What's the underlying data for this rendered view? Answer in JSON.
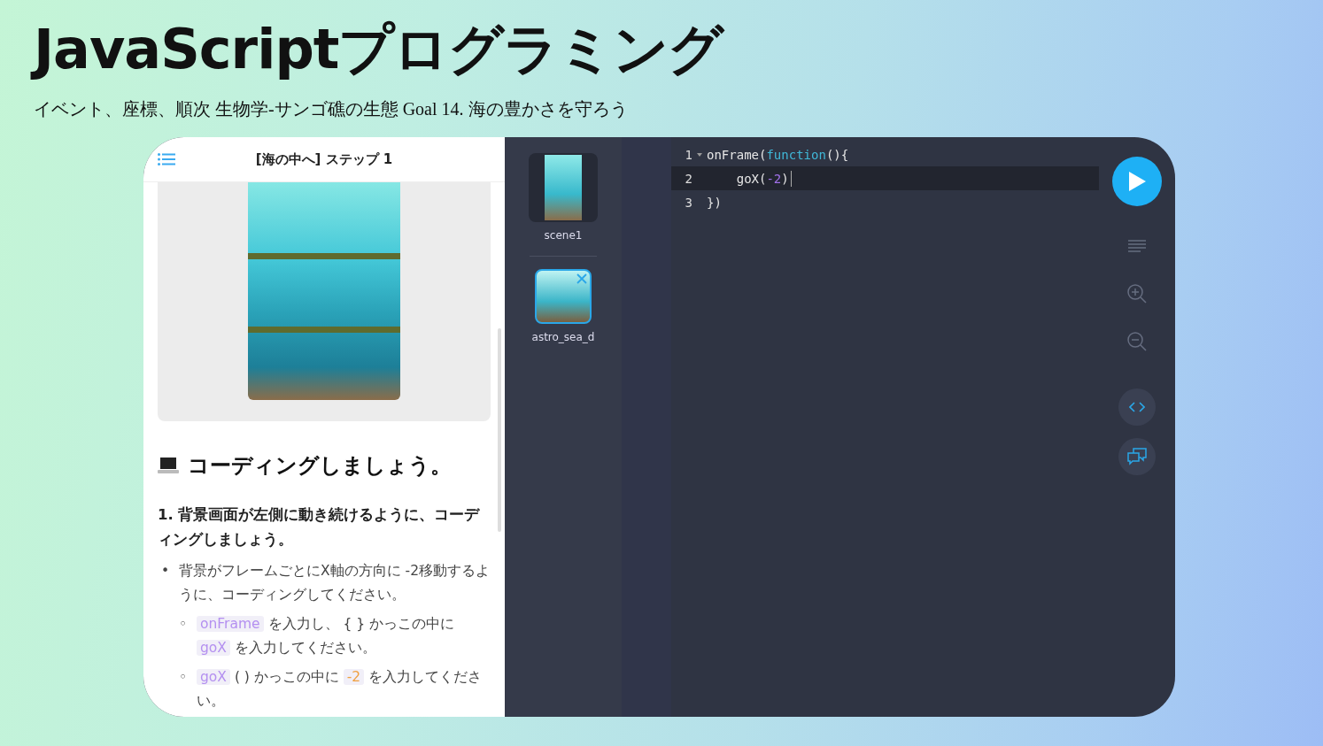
{
  "slide": {
    "title": "JavaScriptプログラミング",
    "subtitle": "イベント、座標、順次 生物学-サンゴ礁の生態 Goal 14. 海の豊かさを守ろう"
  },
  "lesson": {
    "header_title": "[海の中へ] ステップ 1",
    "heading": "コーディングしましょう。",
    "steps": [
      {
        "text": "1. 背景画面が左側に動き続けるように、コーディングしましょう。",
        "bullets": [
          {
            "marker": "•",
            "text": "背景がフレームごとにX軸の方向に -2移動するように、コーディングしてください。",
            "subitems": [
              {
                "marker": "◦",
                "parts": [
                  {
                    "kind": "code",
                    "text": "onFrame"
                  },
                  {
                    "kind": "text",
                    "text": " を入力し、 { } かっこの中に "
                  },
                  {
                    "kind": "code",
                    "text": "goX"
                  },
                  {
                    "kind": "text",
                    "text": " を入力してください。"
                  }
                ]
              },
              {
                "marker": "◦",
                "parts": [
                  {
                    "kind": "code",
                    "text": "goX"
                  },
                  {
                    "kind": "text",
                    "text": " ( ) かっこの中に "
                  },
                  {
                    "kind": "number",
                    "text": "-2"
                  },
                  {
                    "kind": "text",
                    "text": " を入力してください。"
                  }
                ]
              }
            ]
          }
        ]
      }
    ]
  },
  "scenes": [
    {
      "label": "scene1",
      "kind": "scene",
      "selected": false
    },
    {
      "label": "astro_sea_d",
      "kind": "sprite",
      "selected": true
    }
  ],
  "code_lines": [
    {
      "number": "1",
      "foldable": true,
      "active": false,
      "tokens": [
        {
          "kind": "plain",
          "text": "onFrame("
        },
        {
          "kind": "keyword",
          "text": "function"
        },
        {
          "kind": "plain",
          "text": "(){"
        }
      ]
    },
    {
      "number": "2",
      "foldable": false,
      "active": true,
      "tokens": [
        {
          "kind": "plain",
          "text": "    goX("
        },
        {
          "kind": "number",
          "text": "-2"
        },
        {
          "kind": "plain",
          "text": ")"
        }
      ]
    },
    {
      "number": "3",
      "foldable": false,
      "active": false,
      "tokens": [
        {
          "kind": "plain",
          "text": "})"
        }
      ]
    }
  ]
}
